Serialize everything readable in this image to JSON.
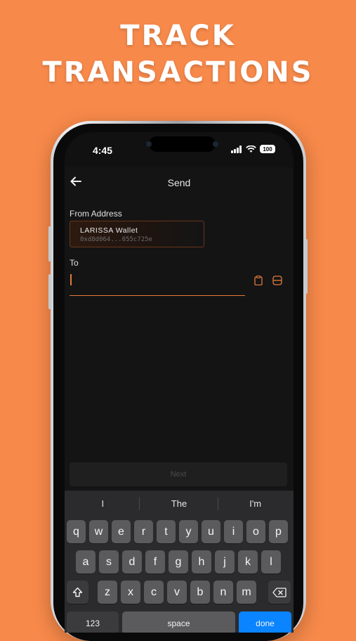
{
  "promo": {
    "line1": "TRACK",
    "line2": "TRANSACTIONS"
  },
  "status_bar": {
    "time": "4:45",
    "battery": "100"
  },
  "header": {
    "title": "Send"
  },
  "from": {
    "label": "From Address",
    "wallet_name": "LARISSA Wallet",
    "wallet_address": "0xd8d064...055c725e"
  },
  "to": {
    "label": "To",
    "value": "",
    "placeholder": ""
  },
  "next_button": {
    "label": "Next"
  },
  "keyboard": {
    "suggestions": [
      "I",
      "The",
      "I'm"
    ],
    "row1": [
      "q",
      "w",
      "e",
      "r",
      "t",
      "y",
      "u",
      "i",
      "o",
      "p"
    ],
    "row2": [
      "a",
      "s",
      "d",
      "f",
      "g",
      "h",
      "j",
      "k",
      "l"
    ],
    "row3": [
      "z",
      "x",
      "c",
      "v",
      "b",
      "n",
      "m"
    ],
    "numbers_key": "123",
    "space_key": "space",
    "done_key": "done"
  },
  "colors": {
    "background": "#f7894a",
    "accent": "#e47a3a",
    "done": "#0a84ff"
  }
}
